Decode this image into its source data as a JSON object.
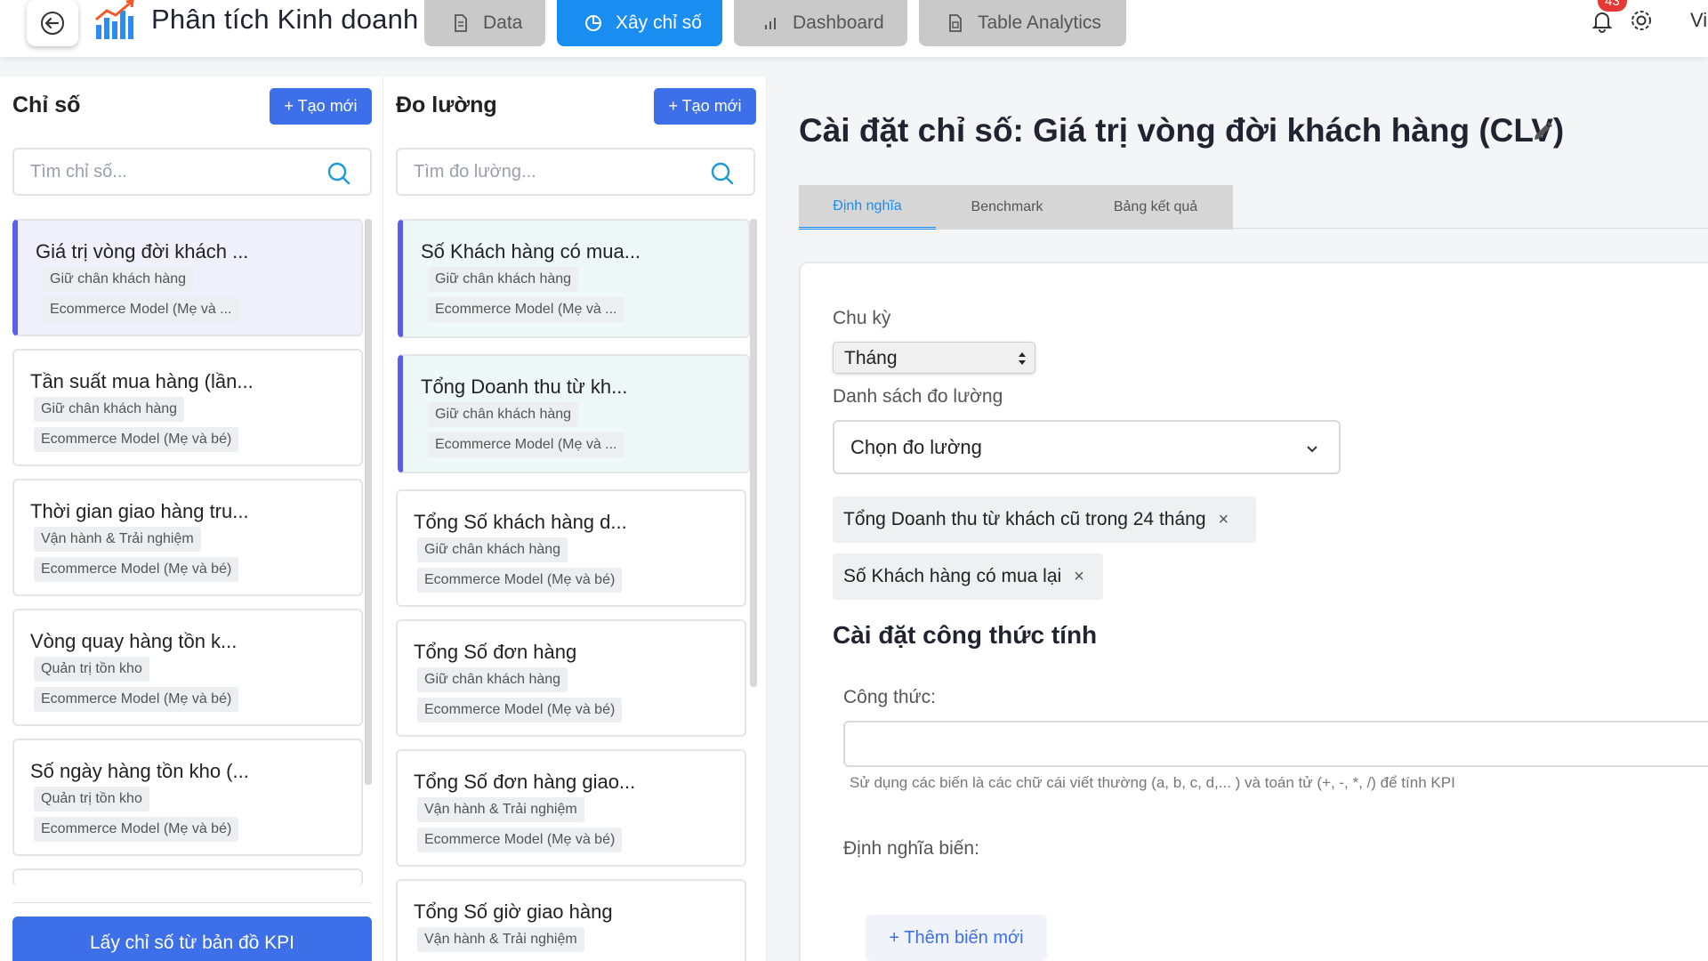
{
  "header": {
    "title": "Phân tích Kinh doanh",
    "nav": [
      {
        "label": "Data",
        "icon": "document-icon"
      },
      {
        "label": "Xây chỉ số",
        "icon": "pie-chart-icon"
      },
      {
        "label": "Dashboard",
        "icon": "bar-chart-icon"
      },
      {
        "label": "Table Analytics",
        "icon": "spreadsheet-icon"
      }
    ],
    "notification_count": "43",
    "user_trunc": "Vi"
  },
  "metrics": {
    "title": "Chỉ số",
    "new_label": "+ Tạo mới",
    "search_placeholder": "Tìm chỉ số...",
    "items": [
      {
        "title": "Giá trị vòng đời khách ...",
        "tag1": "Giữ chân khách hàng",
        "tag2": "Ecommerce Model (Mẹ và ..."
      },
      {
        "title": "Tần suất mua hàng (lần...",
        "tag1": "Giữ chân khách hàng",
        "tag2": "Ecommerce Model (Mẹ và bé)"
      },
      {
        "title": "Thời gian giao hàng tru...",
        "tag1": "Vận hành & Trải nghiệm",
        "tag2": "Ecommerce Model (Mẹ và bé)"
      },
      {
        "title": "Vòng quay hàng tồn k...",
        "tag1": "Quản trị tồn kho",
        "tag2": "Ecommerce Model (Mẹ và bé)"
      },
      {
        "title": "Số ngày hàng tồn kho (...",
        "tag1": "Quản trị tồn kho",
        "tag2": "Ecommerce Model (Mẹ và bé)"
      }
    ],
    "kpi_button": "Lấy chỉ số từ bản đồ KPI"
  },
  "measures": {
    "title": "Đo lường",
    "new_label": "+ Tạo mới",
    "search_placeholder": "Tìm đo lường...",
    "items": [
      {
        "title": "Số Khách hàng có mua...",
        "tag1": "Giữ chân khách hàng",
        "tag2": "Ecommerce Model (Mẹ và ..."
      },
      {
        "title": "Tổng Doanh thu từ kh...",
        "tag1": "Giữ chân khách hàng",
        "tag2": "Ecommerce Model (Mẹ và ..."
      },
      {
        "title": "Tổng Số khách hàng d...",
        "tag1": "Giữ chân khách hàng",
        "tag2": "Ecommerce Model (Mẹ và bé)"
      },
      {
        "title": "Tổng Số đơn hàng",
        "tag1": "Giữ chân khách hàng",
        "tag2": "Ecommerce Model (Mẹ và bé)"
      },
      {
        "title": "Tổng Số đơn hàng giao...",
        "tag1": "Vận hành & Trải nghiệm",
        "tag2": "Ecommerce Model (Mẹ và bé)"
      },
      {
        "title": "Tổng Số giờ giao hàng",
        "tag1": "Vận hành & Trải nghiệm",
        "tag2": ""
      }
    ]
  },
  "detail": {
    "title": "Cài đặt chỉ số: Giá trị vòng đời khách hàng (CLV)",
    "tabs": [
      "Định nghĩa",
      "Benchmark",
      "Bảng kết quả"
    ],
    "cycle_label": "Chu kỳ",
    "cycle_value": "Tháng",
    "measure_list_label": "Danh sách đo lường",
    "measure_select_placeholder": "Chọn đo lường",
    "chips": [
      "Tổng Doanh thu từ khách cũ trong 24 tháng",
      "Số Khách hàng có mua lại"
    ],
    "chip_close": "×",
    "formula_section": "Cài đặt công thức tính",
    "formula_label": "Công thức:",
    "formula_hint": "Sử dụng các biến là các chữ cái viết thường (a, b, c, d,... ) và toán tử (+, -, *, /) để tính KPI",
    "variables_label": "Định nghĩa biến:",
    "add_variable": "+ Thêm biến mới"
  },
  "colors": {
    "primary": "#3d6fe8",
    "active_tab": "#1a8df0",
    "badge": "#e53935"
  }
}
